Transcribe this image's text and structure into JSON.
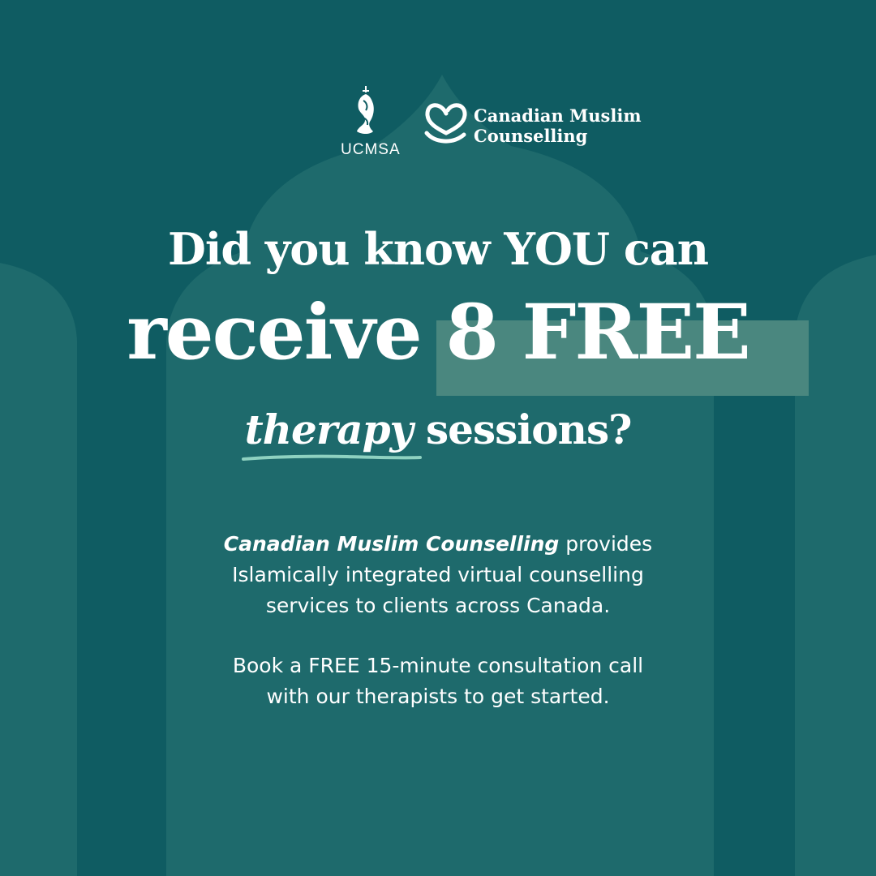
{
  "colors": {
    "background": "#0f5c62",
    "arch": "#1e6a6c",
    "highlight": "#4a877f",
    "underline": "#8ed1c0",
    "text": "#ffffff"
  },
  "logos": {
    "ucmsa": {
      "text": "UCMSA",
      "icon": "ucmsa-emblem-icon"
    },
    "cmc": {
      "line1": "Canadian Muslim",
      "line2": "Counselling",
      "icon": "heart-icon"
    }
  },
  "headline": {
    "line1": "Did you know YOU can",
    "line2_part1": "receive ",
    "line2_part2": "8 FREE",
    "line3_emphasis": "therapy",
    "line3_rest": " sessions?"
  },
  "body": {
    "para1_bold": "Canadian Muslim Counselling",
    "para1_line1_rest": " provides",
    "para1_line2": "Islamically integrated virtual counselling",
    "para1_line3": "services to clients across Canada.",
    "para2_line1": "Book a FREE 15-minute consultation call",
    "para2_line2": "with our therapists to get started."
  }
}
